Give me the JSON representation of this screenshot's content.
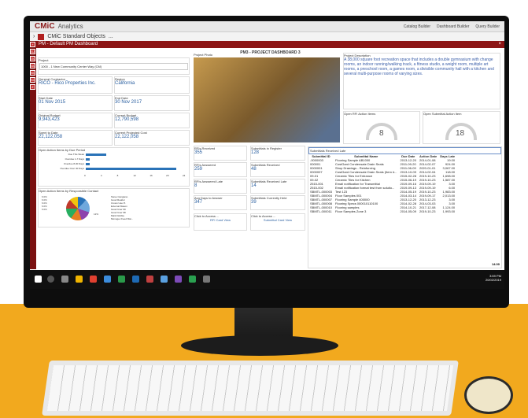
{
  "header": {
    "logo": "CMiC",
    "app": "Analytics",
    "builders": [
      "Catalog Builder",
      "Dashboard Builder",
      "Query Builder"
    ]
  },
  "subheader": {
    "title": "CMiC Standard Objects",
    "more": "..."
  },
  "nav_items": [
    "GJ",
    "OC",
    "GC",
    "NO",
    "SO",
    "Z"
  ],
  "dashboard": {
    "panel_title": "PM - Default PM Dashboard",
    "close": "×",
    "title": "PM3 - PROJECT DASHBOARD 3"
  },
  "project": {
    "label": "Project",
    "value": "1000 - 1 New Community Center Way (CM)"
  },
  "contractor": {
    "label": "General Contractor",
    "value": "RICO - Rico Properties Inc."
  },
  "region": {
    "label": "Region",
    "value": "California"
  },
  "start": {
    "label": "Start Date",
    "value": "01 Nov 2015"
  },
  "end": {
    "label": "End Date",
    "value": "30 Nov 2017"
  },
  "orig_budget": {
    "label": "Original Budget",
    "value": "9,943,423"
  },
  "cur_budget": {
    "label": "Current Budget",
    "value": "12,790,598"
  },
  "spent": {
    "label": "Spent to Date",
    "value": "22,122,058"
  },
  "proj_cost": {
    "label": "Current Projected Cost",
    "value": "22,122,058"
  },
  "photo_label": "Project Photo",
  "description": {
    "label": "Project Description",
    "text": "A 38,000 square foot recreation space that includes a double gymnasium with change rooms, an indoor running/walking track, a fitness studio, a weight room, multiple art rooms, a preschool room, a games room, a divisible community hall with a kitchen and several multi-purpose rooms of varying sizes."
  },
  "rfi_gauge": {
    "label": "Open RFI Action Items",
    "value": "8"
  },
  "sub_gauge": {
    "label": "Open Submittal Action Item",
    "value": "18"
  },
  "due_chart": {
    "title": "Open Action Items by Due Period",
    "categories": [
      "Due This Week",
      "Overdue 1-7 Days",
      "Overdue 8-30 Days",
      "Overdue Over 30 Days"
    ],
    "values": [
      5,
      1,
      1,
      22
    ],
    "ticks": [
      "0",
      "4",
      "8",
      "12",
      "16",
      "20",
      "24"
    ]
  },
  "contact_chart": {
    "title": "Open Action Items by Responsible Contact",
    "pct": [
      "6.0%",
      "6.0%",
      "6.0%",
      "6.0%",
      "6.0%",
      "12%"
    ],
    "legend": [
      "Steve Cangiano",
      "Good Realtor",
      "Crown User 5",
      "External Mason",
      "Good User 99",
      "Good User 98",
      "Mark Dobbie",
      "Monogev Feed Mai..."
    ]
  },
  "kpis": [
    {
      "label": "RFIs Received",
      "value": "355"
    },
    {
      "label": "Submittals in Register",
      "value": "128"
    },
    {
      "label": "RFIs Answered",
      "value": "259"
    },
    {
      "label": "Submittals Received",
      "value": "48"
    },
    {
      "label": "RFIs Answered Late",
      "value": "8"
    },
    {
      "label": "Submittals Received Late",
      "value": "14"
    },
    {
      "label": "Avg Days to Answer",
      "value": "347"
    },
    {
      "label": "Submittals Currently Held",
      "value": "39"
    }
  ],
  "click_access": [
    "Click to Access ...",
    "Click to Access ..."
  ],
  "card_views": [
    "RFI Card View",
    "Submittal Card View"
  ],
  "late_table": {
    "title": "Submittals Received Late",
    "headers": [
      "Submittal ID",
      "Submittal Name",
      "Due Date",
      "Action Date",
      "Days Late"
    ],
    "rows": [
      [
        "-0000003",
        "Flooring Sample AB1000",
        "2013-12-20",
        "2014-01-08",
        "19.00"
      ],
      [
        "000001",
        "CostGard Condensate Drain Seals",
        "2011-09-20",
        "2014-02-07",
        "924.00"
      ],
      [
        "0000001",
        "Shop Drawings - Reinforcing",
        "2011-06-09",
        "2020-01-01",
        "3,067.00"
      ],
      [
        "0000007",
        "CostGard Condensate Drain Seals (Item #...",
        "2013-10-09",
        "2014-02-04",
        "118.00"
      ],
      [
        "09-01",
        "Ceramic Tiles for Entrance",
        "2015-02-28",
        "2019-10-23",
        "1,698.00"
      ],
      [
        "09-02",
        "Ceramic Tiles for Kitchen",
        "2015-06-19",
        "2019-10-23",
        "1,587.00"
      ],
      [
        "2515-001",
        "Email notification for Transmittal",
        "2019-09-16",
        "2019-09-19",
        "3.00"
      ],
      [
        "2515-002",
        "Email notification format test from solutio...",
        "2019-09-13",
        "2019-09-19",
        "6.00"
      ],
      [
        "SBMTL-000003",
        "Test 123",
        "2014-05-19",
        "2019-10-23",
        "1,983.00"
      ],
      [
        "SBMTL-000004",
        "Floor Samples 001",
        "2014-03-14",
        "2019-09-17",
        "2,013.00"
      ],
      [
        "SBMTL-000007",
        "Flooring Sample 400000",
        "2013-12-20",
        "2013-12-23",
        "3.00"
      ],
      [
        "SBMTL-000008",
        "Flooring Specs 000010110100",
        "2014-02-28",
        "2014-03-03",
        "3.00"
      ],
      [
        "SBMTL-000010",
        "Flooring samples",
        "2014-10-21",
        "2017-12-08",
        "1,124.00"
      ],
      [
        "SBMTL-000011",
        "Floor Samples Zone 3",
        "2014-05-09",
        "2019-10-23",
        "1,993.00"
      ]
    ],
    "total": "14.00"
  },
  "clock": {
    "time": "3:59 PM",
    "date": "20/02/2019"
  }
}
